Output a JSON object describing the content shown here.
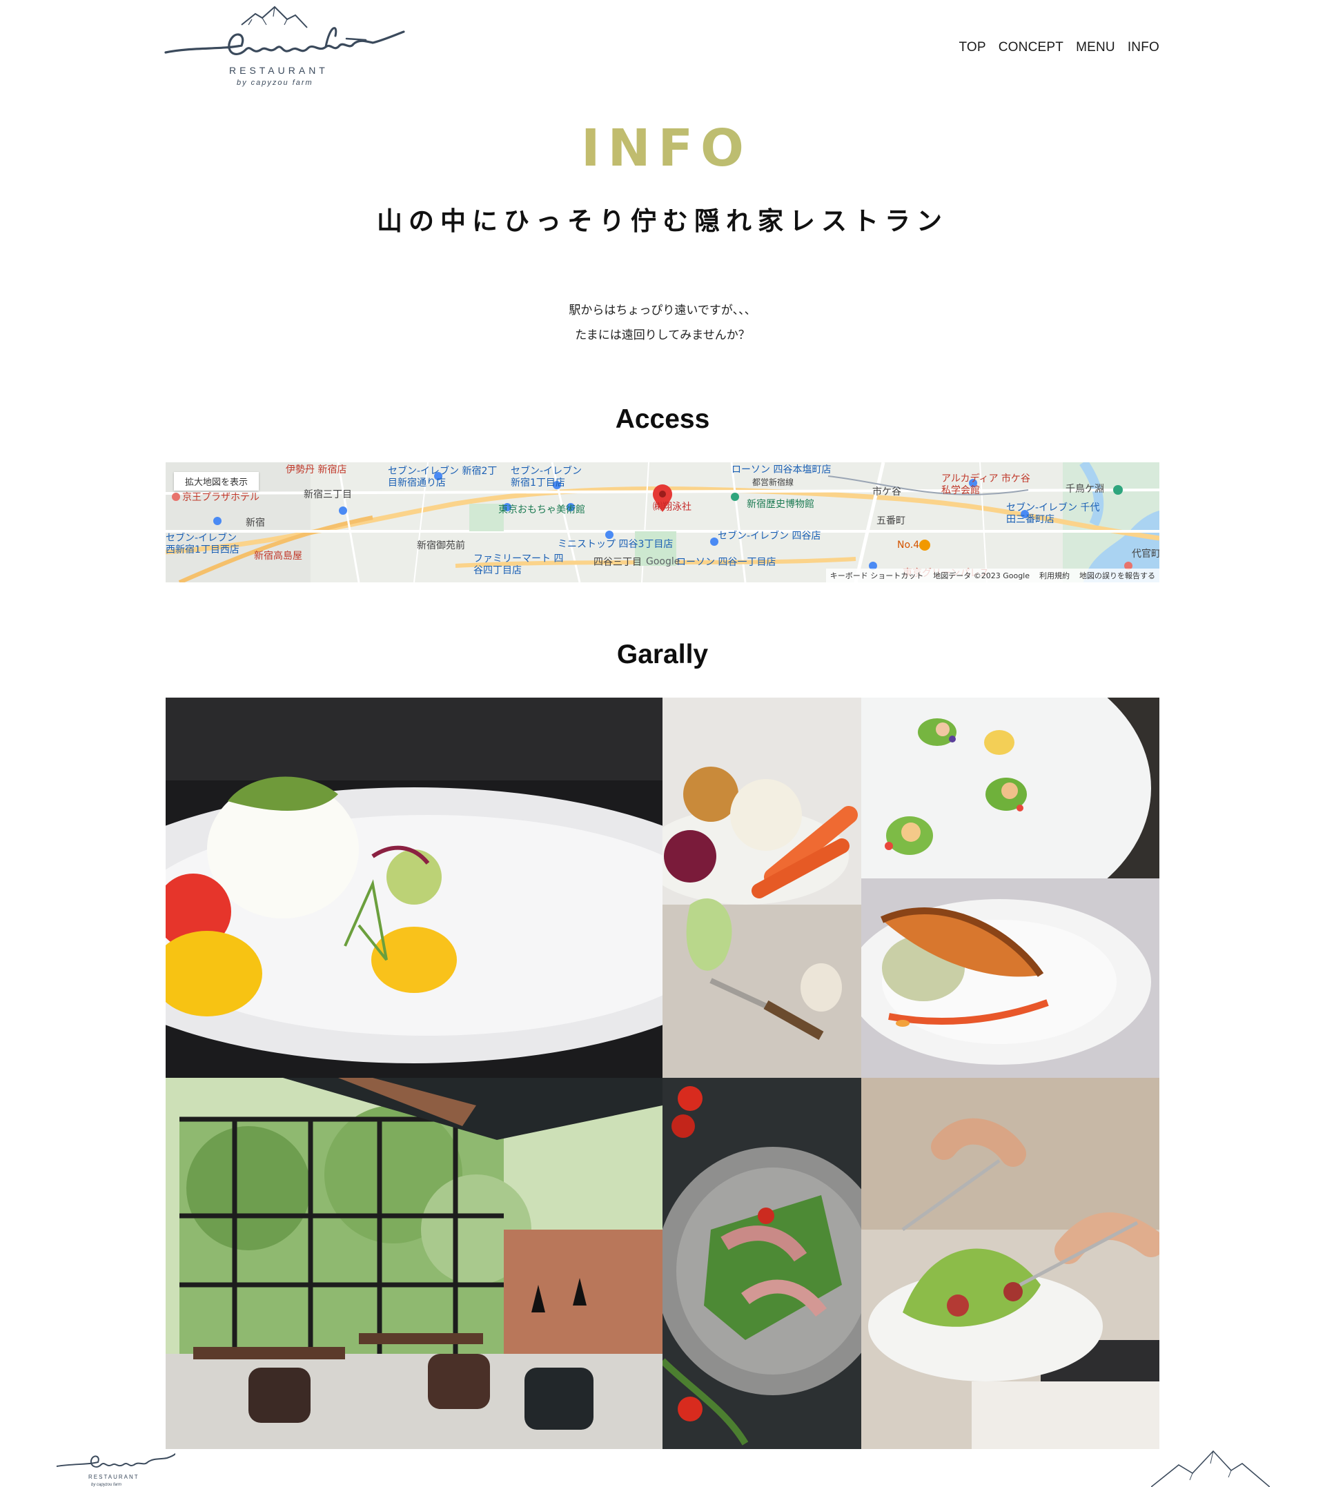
{
  "brand": {
    "script_name": "harvest",
    "tagline": "RESTAURANT",
    "byline": "by capyzou farm"
  },
  "nav": {
    "items": [
      "TOP",
      "CONCEPT",
      "MENU",
      "INFO"
    ]
  },
  "hero": {
    "title": "INFO",
    "subtitle": "山の中にひっそり佇む隠れ家レストラン",
    "intro_line1": "駅からはちょっぴり遠いですが、、、",
    "intro_line2": "たまには遠回りしてみませんか？"
  },
  "access": {
    "heading": "Access",
    "map": {
      "enlarge_link": "拡大地図を表示",
      "pin_label": "㈱翔泳社",
      "footer_items": [
        "キーボード ショートカット",
        "地図データ ©2023 Google",
        "利用規約",
        "地図の誤りを報告する"
      ],
      "google": "Google",
      "places": [
        {
          "text": "伊勢丹 新宿店",
          "tone": "red"
        },
        {
          "text": "京王プラザホテル",
          "tone": "red"
        },
        {
          "text": "新宿三丁目",
          "tone": "dark"
        },
        {
          "text": "新宿",
          "tone": "dark"
        },
        {
          "text": "新宿高島屋",
          "tone": "red"
        },
        {
          "text": "セブン-イレブン 西新宿1丁目西店",
          "tone": "blue"
        },
        {
          "text": "セブン-イレブン 新宿2丁目新宿通り店",
          "tone": "blue"
        },
        {
          "text": "セブン-イレブン 新宿1丁目店",
          "tone": "blue"
        },
        {
          "text": "東京おもちゃ美術館",
          "tone": "green"
        },
        {
          "text": "新宿御苑前",
          "tone": "dark"
        },
        {
          "text": "ファミリーマート 四谷四丁目店",
          "tone": "blue"
        },
        {
          "text": "ミニストップ 四谷3丁目店",
          "tone": "blue"
        },
        {
          "text": "四谷三丁目",
          "tone": "dark"
        },
        {
          "text": "ローソン 四谷一丁目店",
          "tone": "blue"
        },
        {
          "text": "ローソン 四谷本塩町店",
          "tone": "blue"
        },
        {
          "text": "新宿歴史博物館",
          "tone": "green"
        },
        {
          "text": "セブン-イレブン 四谷店",
          "tone": "blue"
        },
        {
          "text": "都営新宿線",
          "tone": "dark"
        },
        {
          "text": "市ケ谷",
          "tone": "dark"
        },
        {
          "text": "アルカディア 市ケ谷 私学会館",
          "tone": "red"
        },
        {
          "text": "五番町",
          "tone": "dark"
        },
        {
          "text": "No.4",
          "tone": "orange"
        },
        {
          "text": "千鳥ケ淵",
          "tone": "dark"
        },
        {
          "text": "セブン-イレブン 千代田三番町店",
          "tone": "blue"
        },
        {
          "text": "東京グリーンパレス",
          "tone": "red"
        },
        {
          "text": "代官町",
          "tone": "dark"
        }
      ]
    }
  },
  "gallery": {
    "heading": "Garally",
    "tiles": [
      {
        "subject": "burrata-plate"
      },
      {
        "subject": "vegetables-board"
      },
      {
        "subject": "green-canapes"
      },
      {
        "subject": "salmon-plate"
      },
      {
        "subject": "restaurant-interior"
      },
      {
        "subject": "prosciutto-salad"
      },
      {
        "subject": "salad-dining"
      }
    ]
  },
  "colors": {
    "title_gradient": [
      "#d5b766",
      "#bdbd70",
      "#9fc47d"
    ],
    "logo": "#3b4a5c"
  }
}
